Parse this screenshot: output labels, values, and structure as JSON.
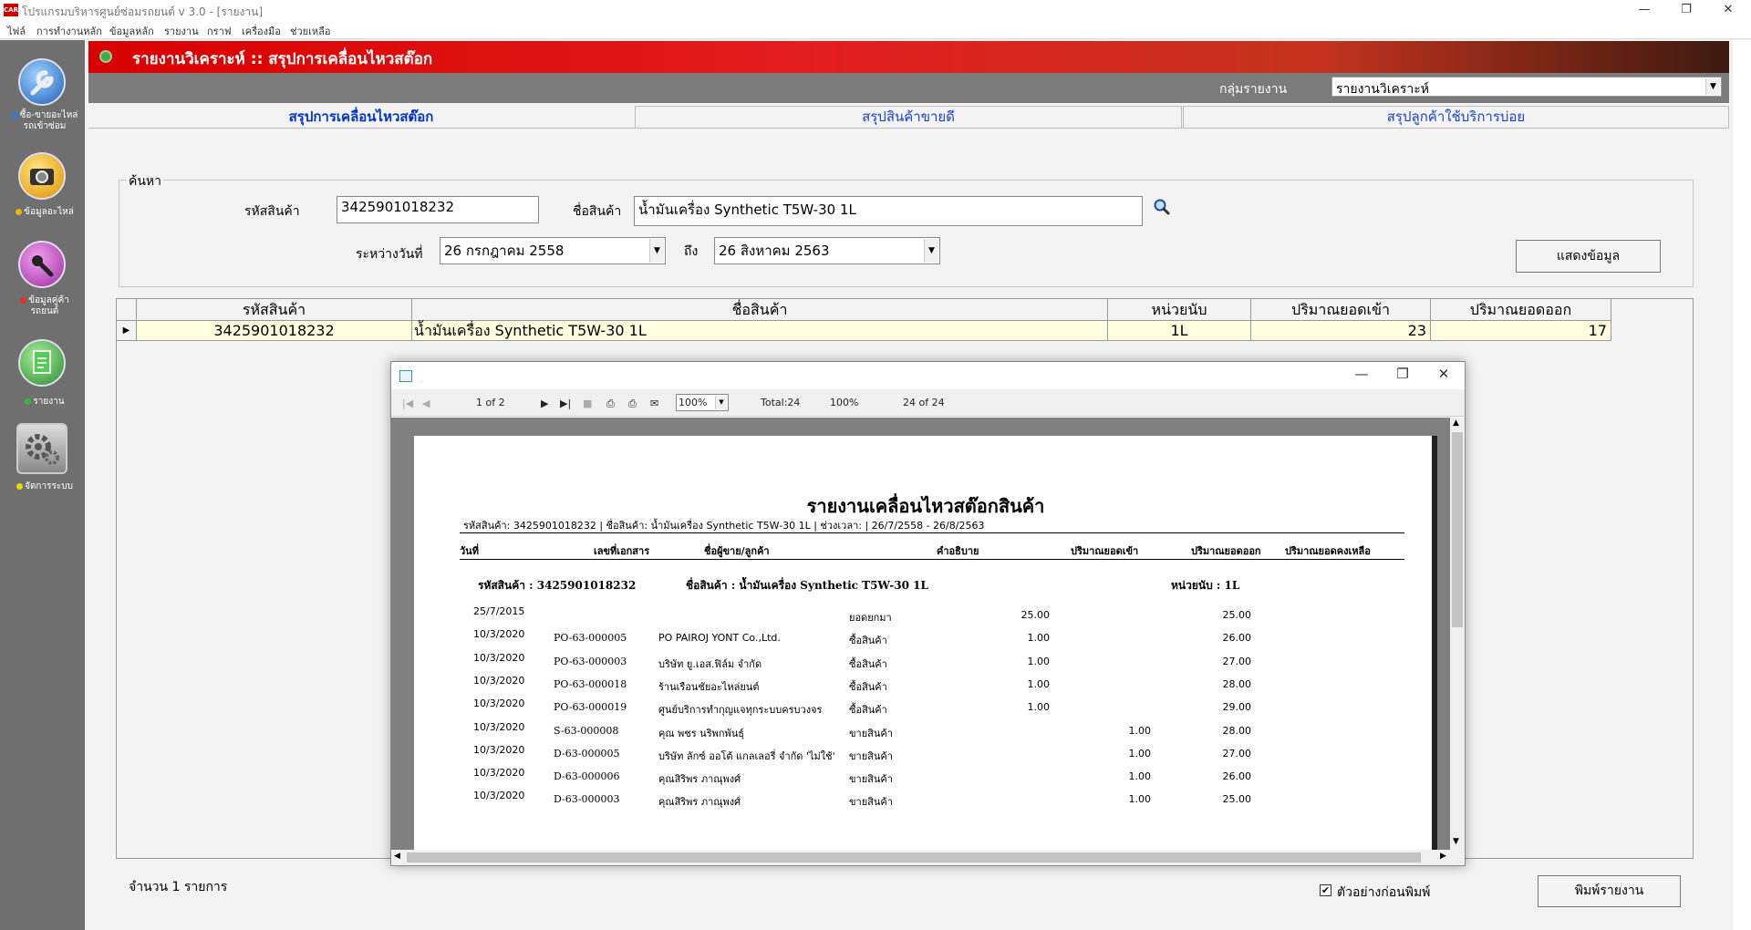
{
  "window": {
    "app_badge": "CAR",
    "title": "โปรแกรมบริหารศูนย์ซ่อมรถยนต์ v 3.0 - [รายงาน]",
    "minimize": "—",
    "restore": "❐",
    "close": "✕"
  },
  "menu": [
    "ไฟล์",
    "การทำงานหลัก",
    "ข้อมูลหลัก",
    "รายงาน",
    "กราฟ",
    "เครื่องมือ",
    "ช่วยเหลือ"
  ],
  "sidebar": [
    {
      "label": "ซื้อ-ขายอะไหล่ รถเข้าซ่อม",
      "icon": "wrench-icon",
      "dot": "#2f7bd8"
    },
    {
      "label": "ข้อมูลอะไหล่",
      "icon": "camera-icon",
      "dot": "#e6b800"
    },
    {
      "label": "ข้อมูลคู่ค้า รถยนต์",
      "icon": "key-icon",
      "dot": "#e03030"
    },
    {
      "label": "รายงาน",
      "icon": "clipboard-icon",
      "dot": "#3cb043"
    },
    {
      "label": "จัดการระบบ",
      "icon": "gear-icon",
      "dot": "#e6d800"
    }
  ],
  "header": {
    "title": "รายงานวิเคราะห์ :: สรุปการเคลื่อนไหวสต๊อก"
  },
  "group": {
    "label": "กลุ่มรายงาน",
    "value": "รายงานวิเคราะห์"
  },
  "tabs": [
    "สรุปการเคลื่อนไหวสต๊อก",
    "สรุปสินค้าขายดี",
    "สรุปลูกค้าใช้บริการบ่อย"
  ],
  "search": {
    "legend": "ค้นหา",
    "code_label": "รหัสสินค้า",
    "code_value": "3425901018232",
    "name_label": "ชื่อสินค้า",
    "name_value": "น้ำมันเครื่อง Synthetic T5W-30 1L",
    "between_label": "ระหว่างวันที่",
    "date_from": "26  กรกฎาคม   2558",
    "to_label": "ถึง",
    "date_to": "26  สิงหาคม    2563",
    "show_button": "แสดงข้อมูล"
  },
  "grid": {
    "columns": [
      "รหัสสินค้า",
      "ชื่อสินค้า",
      "หน่วยนับ",
      "ปริมาณยอดเข้า",
      "ปริมาณยอดออก"
    ],
    "rows": [
      {
        "code": "3425901018232",
        "name": "น้ำมันเครื่อง Synthetic T5W-30 1L",
        "unit": "1L",
        "in": "23",
        "out": "17"
      }
    ]
  },
  "footer": {
    "count": "จำนวน 1 รายการ",
    "preview_checkbox": "ตัวอย่างก่อนพิมพ์",
    "preview_checked": "✔",
    "print_button": "พิมพ์รายงาน"
  },
  "viewer": {
    "page": "1 of 2",
    "zoom": "100%",
    "total": "Total:24",
    "percent": "100%",
    "count": "24 of 24",
    "report": {
      "title": "รายงานเคลื่อนไหวสต๊อกสินค้า",
      "subtitle": "รหัสสินค้า: 3425901018232 |  ชื่อสินค้า: น้ำมันเครื่อง Synthetic T5W-30 1L |  ช่วงเวลา:  | 26/7/2558 - 26/8/2563",
      "columns": [
        "วันที่",
        "เลขที่เอกสาร",
        "ชื่อผู้ขาย/ลูกค้า",
        "คำอธิบาย",
        "ปริมาณยอดเข้า",
        "ปริมาณยอดออก",
        "ปริมาณยอดคงเหลือ"
      ],
      "group_code": "รหัสสินค้า : 3425901018232",
      "group_name": "ชื่อสินค้า : น้ำมันเครื่อง Synthetic T5W-30 1L",
      "group_unit": "หน่วยนับ :  1L",
      "rows": [
        {
          "date": "25/7/2015",
          "doc": "",
          "party": "",
          "desc": "ยอดยกมา",
          "in": "25.00",
          "out": "",
          "bal": "25.00"
        },
        {
          "date": "10/3/2020",
          "doc": "PO-63-000005",
          "party": "PO PAIROJ YONT Co.,Ltd.",
          "desc": "ซื้อสินค้า",
          "in": "1.00",
          "out": "",
          "bal": "26.00"
        },
        {
          "date": "10/3/2020",
          "doc": "PO-63-000003",
          "party": "บริษัท ยู.เอส.ฟิล์ม จำกัด",
          "desc": "ซื้อสินค้า",
          "in": "1.00",
          "out": "",
          "bal": "27.00"
        },
        {
          "date": "10/3/2020",
          "doc": "PO-63-000018",
          "party": "ร้านเรือนชัยอะไหล่ยนต์",
          "desc": "ซื้อสินค้า",
          "in": "1.00",
          "out": "",
          "bal": "28.00"
        },
        {
          "date": "10/3/2020",
          "doc": "PO-63-000019",
          "party": "ศูนย์บริการทำกุญแจทุกระบบครบวงจร",
          "desc": "ซื้อสินค้า",
          "in": "1.00",
          "out": "",
          "bal": "29.00"
        },
        {
          "date": "10/3/2020",
          "doc": "S-63-000008",
          "party": "คุณ พชร นริพกพันธุ์",
          "desc": "ขายสินค้า",
          "in": "",
          "out": "1.00",
          "bal": "28.00"
        },
        {
          "date": "10/3/2020",
          "doc": "D-63-000005",
          "party": "บริษัท ลักซ์ ออโต้ แกลเลอรี่ จำกัด 'ไม่ใช้'",
          "desc": "ขายสินค้า",
          "in": "",
          "out": "1.00",
          "bal": "27.00"
        },
        {
          "date": "10/3/2020",
          "doc": "D-63-000006",
          "party": "คุณสิริพร ภาณุพงศ์",
          "desc": "ขายสินค้า",
          "in": "",
          "out": "1.00",
          "bal": "26.00"
        },
        {
          "date": "10/3/2020",
          "doc": "D-63-000003",
          "party": "คุณสิริพร ภาณุพงศ์",
          "desc": "ขายสินค้า",
          "in": "",
          "out": "1.00",
          "bal": "25.00"
        }
      ]
    }
  }
}
